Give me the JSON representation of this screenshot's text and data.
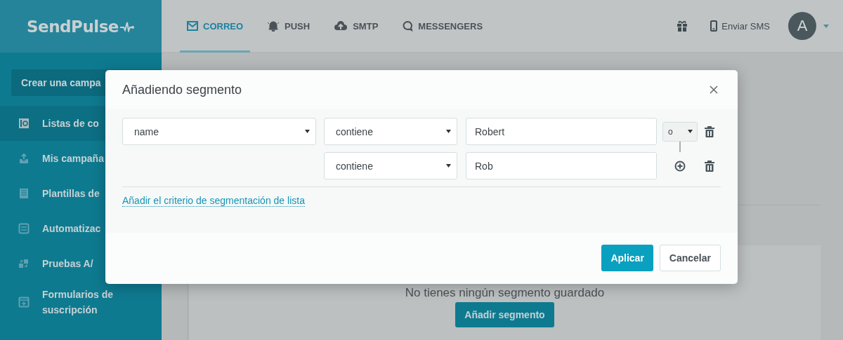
{
  "header": {
    "logo": "SendPulse",
    "tabs": [
      {
        "label": "CORREO",
        "selected": true
      },
      {
        "label": "PUSH",
        "selected": false
      },
      {
        "label": "SMTP",
        "selected": false
      },
      {
        "label": "MESSENGERS",
        "selected": false
      }
    ],
    "sms": "Enviar SMS",
    "avatar": "A"
  },
  "sidebar": {
    "create_button": "Crear una campa",
    "items": [
      {
        "label": "Listas de co",
        "selected": true
      },
      {
        "label": "Mis campaña",
        "selected": false
      },
      {
        "label": "Plantillas de",
        "selected": false
      },
      {
        "label": "Automatizac",
        "selected": false
      },
      {
        "label": "Pruebas A/",
        "selected": false
      },
      {
        "label": "Formularios de suscripción",
        "selected": false
      }
    ]
  },
  "content": {
    "empty_text": "No tienes ningún segmento guardado",
    "add_button": "Añadir segmento"
  },
  "dialog": {
    "title": "Añadiendo segmento",
    "conditions": [
      {
        "field": "name",
        "operator": "contiene",
        "value": "Robert",
        "join": "o"
      },
      {
        "operator": "contiene",
        "value": "Rob"
      }
    ],
    "add_criterion_link": "Añadir el criterio de segmentación de lista",
    "buttons": [
      {
        "label": "Aplicar",
        "kind": "primary"
      },
      {
        "label": "Cancelar",
        "kind": "secondary"
      }
    ]
  }
}
